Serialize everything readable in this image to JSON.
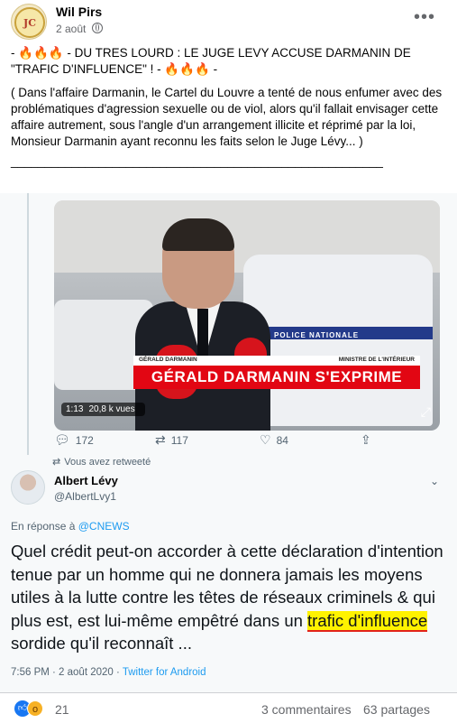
{
  "post": {
    "author": "Wil Pirs",
    "date": "2 août",
    "more_icon": "•••",
    "headline": "- 🔥🔥🔥 - DU TRES LOURD : LE JUGE LEVY ACCUSE DARMANIN DE \"TRAFIC D'INFLUENCE\" ! - 🔥🔥🔥 -",
    "body": "( Dans l'affaire Darmanin, le Cartel du Louvre a tenté de nous enfumer avec des problématiques d'agression sexuelle ou de viol, alors qu'il fallait envisager cette affaire autrement, sous l'angle d'un arrangement illicite et réprimé par la loi, Monsieur Darmanin ayant reconnu les faits selon le Juge Lévy... )",
    "separator": "_______________________________________________________"
  },
  "video": {
    "caption_name": "GÉRALD DARMANIN",
    "caption_role": "MINISTRE DE L'INTÉRIEUR",
    "banner": "GÉRALD DARMANIN S'EXPRIME",
    "van_label": "POLICE NATIONALE",
    "duration": "1:13",
    "views": "20,8 k vues"
  },
  "quoted_actions": {
    "replies": "172",
    "retweets": "117",
    "likes": "84"
  },
  "retweet_note": "Vous avez retweeté",
  "tweet": {
    "name": "Albert Lévy",
    "handle": "@AlbertLvy1",
    "reply_prefix": "En réponse à ",
    "reply_target": "@CNEWS",
    "text_before": "Quel crédit peut-on accorder à cette déclaration d'intention tenue par un homme qui ne donnera jamais les moyens utiles à la lutte contre les têtes de réseaux criminels & qui plus est, est lui-même empêtré dans un ",
    "text_highlight": "trafic d'influence",
    "text_after": " sordide qu'il reconnaît ...",
    "timestamp": "7:56 PM · 2 août 2020 · ",
    "source": "Twitter for Android"
  },
  "footer": {
    "reaction_count": "21",
    "comments": "3 commentaires",
    "shares": "63 partages"
  },
  "colors": {
    "facebook_blue": "#1877f2",
    "twitter_blue": "#1d9bf0",
    "highlight": "#fff200",
    "banner_red": "#e20613"
  }
}
